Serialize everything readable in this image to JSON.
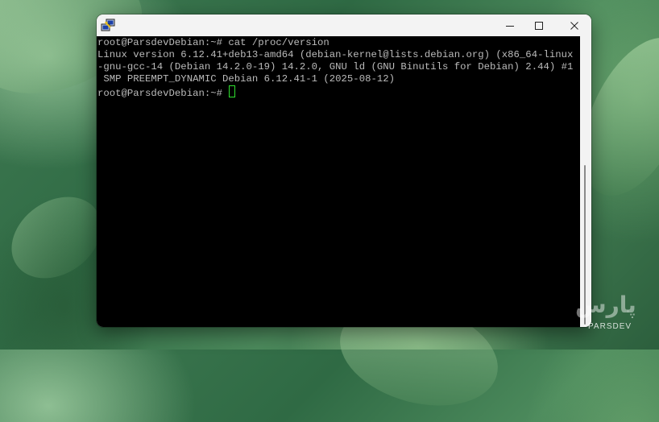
{
  "terminal": {
    "lines": [
      "root@ParsdevDebian:~# cat /proc/version",
      "Linux version 6.12.41+deb13-amd64 (debian-kernel@lists.debian.org) (x86_64-linux",
      "-gnu-gcc-14 (Debian 14.2.0-19) 14.2.0, GNU ld (GNU Binutils for Debian) 2.44) #1",
      " SMP PREEMPT_DYNAMIC Debian 6.12.41-1 (2025-08-12)"
    ],
    "prompt": "root@ParsdevDebian:~# "
  },
  "window_controls": {
    "minimize_icon": "minimize-icon",
    "maximize_icon": "maximize-icon",
    "close_icon": "close-icon"
  },
  "app_icon": "putty-icon",
  "watermark": {
    "brand_logo": "پارس",
    "text": "PARSDEV"
  },
  "colors": {
    "terminal_bg": "#000000",
    "terminal_text": "#bbbbbb",
    "cursor": "#2fe02f",
    "titlebar": "#f3f3f3"
  }
}
